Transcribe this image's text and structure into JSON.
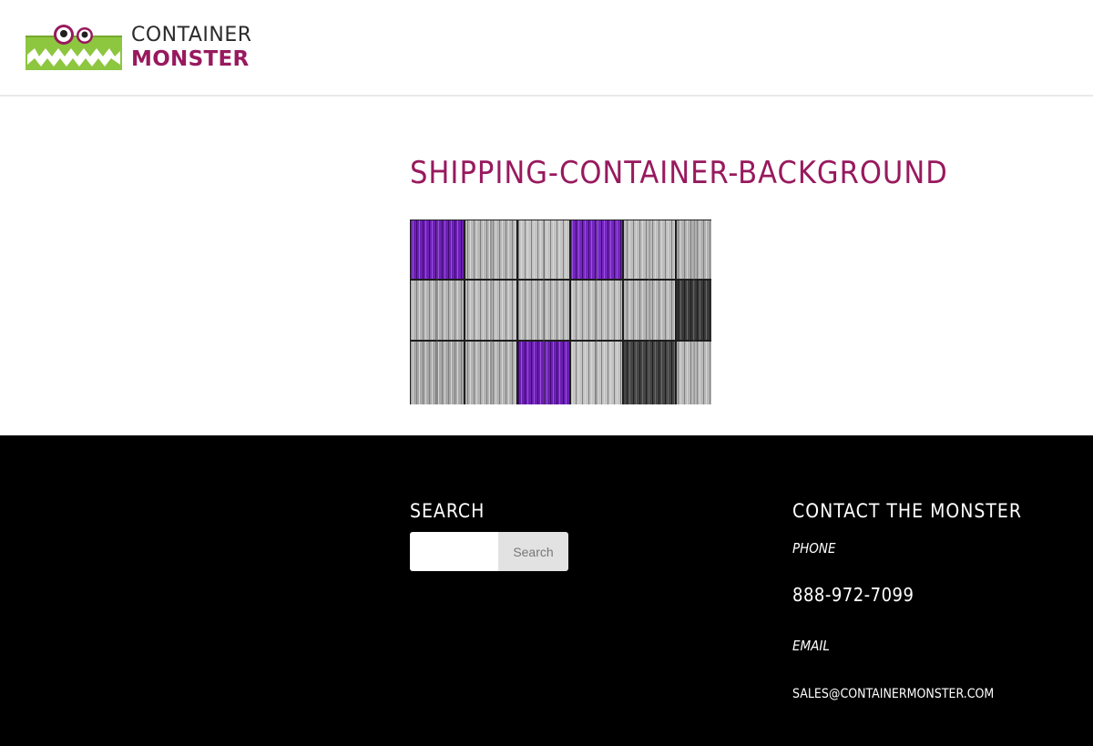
{
  "header": {
    "logo": {
      "line1": "CONTAINER",
      "line2": "MONSTER",
      "icon": "monster-logo-icon",
      "colors": {
        "green": "#8dc63f",
        "purple": "#98195e"
      }
    }
  },
  "main": {
    "page_title": "SHIPPING-CONTAINER-BACKGROUND",
    "featured_image": {
      "icon": "shipping-containers-photo"
    }
  },
  "footer": {
    "search": {
      "title": "SEARCH",
      "input_value": "",
      "button_label": "Search"
    },
    "contact": {
      "title": "CONTACT THE MONSTER",
      "phone_label": "PHONE",
      "phone": "888-972-7099",
      "email_label": "EMAIL",
      "email": "SALES@CONTAINERMONSTER.COM"
    }
  },
  "colors": {
    "accent": "#98195e",
    "footer_bg": "#000000",
    "container_purple": "#6b1fb3"
  }
}
